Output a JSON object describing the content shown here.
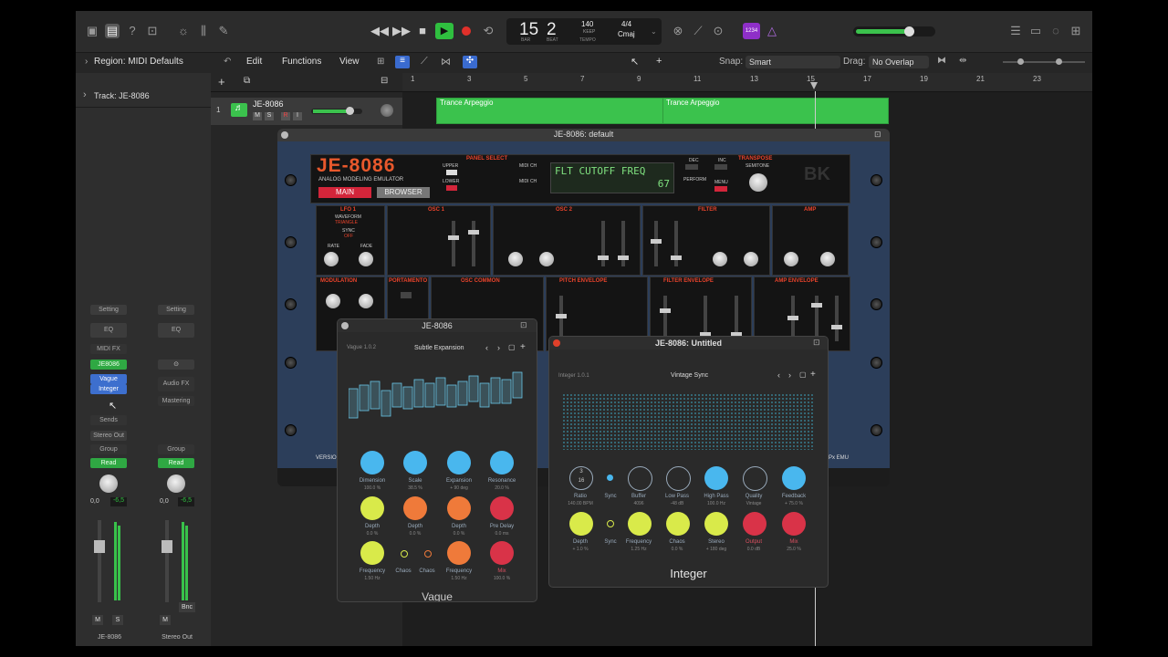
{
  "transport": {
    "bar": "15",
    "beat": "2",
    "bar_label": "BAR",
    "beat_label": "BEAT",
    "tempo": "140",
    "tempo_label": "TEMPO",
    "keep": "KEEP",
    "time_sig": "4/4",
    "key": "Cmaj",
    "badge": "1234"
  },
  "secondary": {
    "edit": "Edit",
    "functions": "Functions",
    "view": "View",
    "snap_label": "Snap:",
    "snap_value": "Smart",
    "drag_label": "Drag:",
    "drag_value": "No Overlap"
  },
  "inspector": {
    "region": "Region: MIDI Defaults",
    "track": "Track: JE-8086",
    "strip1": {
      "setting": "Setting",
      "eq": "EQ",
      "midifx": "MIDI FX",
      "inst": "JE8086",
      "fx1": "Vague",
      "fx2": "Integer",
      "sends": "Sends",
      "output": "Stereo Out",
      "group": "Group",
      "auto": "Read",
      "vol": "0,0",
      "pan": "-6,5",
      "m": "M",
      "s": "S",
      "name": "JE-8086"
    },
    "strip2": {
      "setting": "Setting",
      "eq": "EQ",
      "audiofx": "Audio FX",
      "mastering": "Mastering",
      "group": "Group",
      "auto": "Read",
      "vol": "0,0",
      "pan": "-6,5",
      "bnc": "Bnc",
      "m": "M",
      "name": "Stereo Out"
    }
  },
  "track": {
    "num": "1",
    "name": "JE-8086",
    "m": "M",
    "s": "S",
    "r": "R",
    "i": "I"
  },
  "ruler": [
    "1",
    "3",
    "5",
    "7",
    "9",
    "11",
    "13",
    "15",
    "17",
    "19",
    "21",
    "23"
  ],
  "regions": [
    {
      "label": "Trance Arpeggio"
    },
    {
      "label": "Trance Arpeggio"
    }
  ],
  "je": {
    "title": "JE-8086: default",
    "logo": "JE-8086",
    "subtitle": "ANALOG MODELING EMULATOR",
    "main": "MAIN",
    "browser": "BROWSER",
    "panel_select": "PANEL SELECT",
    "upper": "UPPER",
    "lower": "LOWER",
    "midi_ch": "MIDI CH",
    "lcd_line1": "FLT CUTOFF FREQ",
    "lcd_line2": "67",
    "dec": "DEC",
    "inc": "INC",
    "perform": "PERFORM",
    "menu": "MENU",
    "transpose": "TRANSPOSE",
    "semitone": "SEMITONE",
    "lfo1": "LFO 1",
    "waveform": "WAVEFORM",
    "triangle": "TRIANGLE",
    "sync": "SYNC",
    "off": "OFF",
    "rate": "RATE",
    "fade": "FADE",
    "osc1": "OSC 1",
    "osc2": "OSC 2",
    "filter": "FILTER",
    "amp": "AMP",
    "modulation": "MODULATION",
    "portamento": "PORTAMENTO",
    "osc_common": "OSC COMMON",
    "pitch_env": "PITCH ENVELOPE",
    "filter_env": "FILTER ENVELOPE",
    "amp_env": "AMP ENVELOPE",
    "version": "VERSIO",
    "emu": "SPx EMU"
  },
  "vague": {
    "title": "JE-8086",
    "version": "Vague 1.0.2",
    "preset": "Subtle Expansion",
    "name": "Vague",
    "row1": [
      {
        "l": "Dimension",
        "v": "100.0 %"
      },
      {
        "l": "Scale",
        "v": "38.5 %"
      },
      {
        "l": "Expansion",
        "v": "+ 90 deg"
      },
      {
        "l": "Resonance",
        "v": "20.0 %"
      }
    ],
    "row2": [
      {
        "l": "Depth",
        "v": "0.0 %"
      },
      {
        "l": "Depth",
        "v": "0.0 %"
      },
      {
        "l": "Depth",
        "v": "0.0 %"
      },
      {
        "l": "Pre Delay",
        "v": "0.0 ms"
      }
    ],
    "row3": [
      {
        "l": "Frequency",
        "v": "1.50 Hz"
      },
      {
        "l": "Chaos",
        "v": ""
      },
      {
        "l": "Chaos",
        "v": ""
      },
      {
        "l": "Frequency",
        "v": "1.50 Hz"
      },
      {
        "l": "Mix",
        "v": "100.0 %"
      }
    ]
  },
  "integer": {
    "title": "JE-8086: Untitled",
    "version": "Integer 1.0.1",
    "preset": "Vintage Sync",
    "name": "Integer",
    "ratio_top": "3",
    "ratio_bot": "16",
    "row1": [
      {
        "l": "Ratio",
        "v": "140.00 BPM"
      },
      {
        "l": "Sync",
        "v": ""
      },
      {
        "l": "Buffer",
        "v": "4096"
      },
      {
        "l": "Low Pass",
        "v": "-48 dB"
      },
      {
        "l": "High Pass",
        "v": "100.0 Hz"
      },
      {
        "l": "Quality",
        "v": "Vintage"
      },
      {
        "l": "Feedback",
        "v": "+ 75.0 %"
      }
    ],
    "row2": [
      {
        "l": "Depth",
        "v": "+ 1.0 %"
      },
      {
        "l": "Sync",
        "v": ""
      },
      {
        "l": "Frequency",
        "v": "1.25 Hz"
      },
      {
        "l": "Chaos",
        "v": "0.0 %"
      },
      {
        "l": "Stereo",
        "v": "+ 180 deg"
      },
      {
        "l": "Output",
        "v": "0.0 dB"
      },
      {
        "l": "Mix",
        "v": "25.0 %"
      }
    ]
  }
}
